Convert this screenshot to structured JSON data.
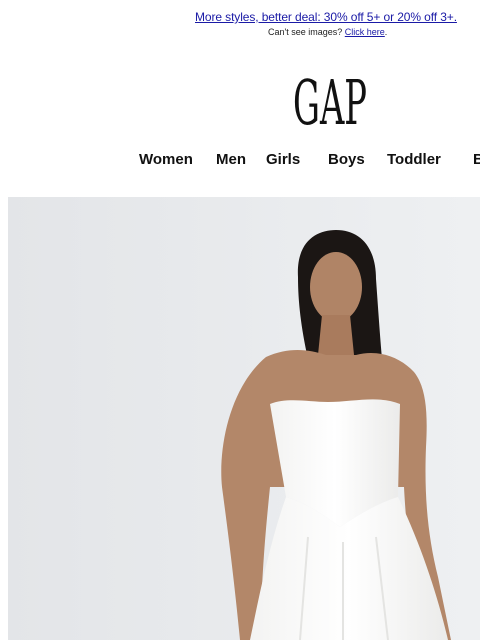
{
  "header": {
    "promo_text": "More styles, better deal: 30% off 5+ or 20% off 3+.",
    "cant_see_text": "Can't see images?",
    "click_here": "Click here",
    "period": ".",
    "logo_text": "GAP"
  },
  "nav": {
    "items": [
      "Women",
      "Men",
      "Girls",
      "Boys",
      "Toddler",
      "B"
    ]
  },
  "hero": {
    "image_alt": "model-in-white-strapless-dress",
    "background": "#e9eaec"
  }
}
